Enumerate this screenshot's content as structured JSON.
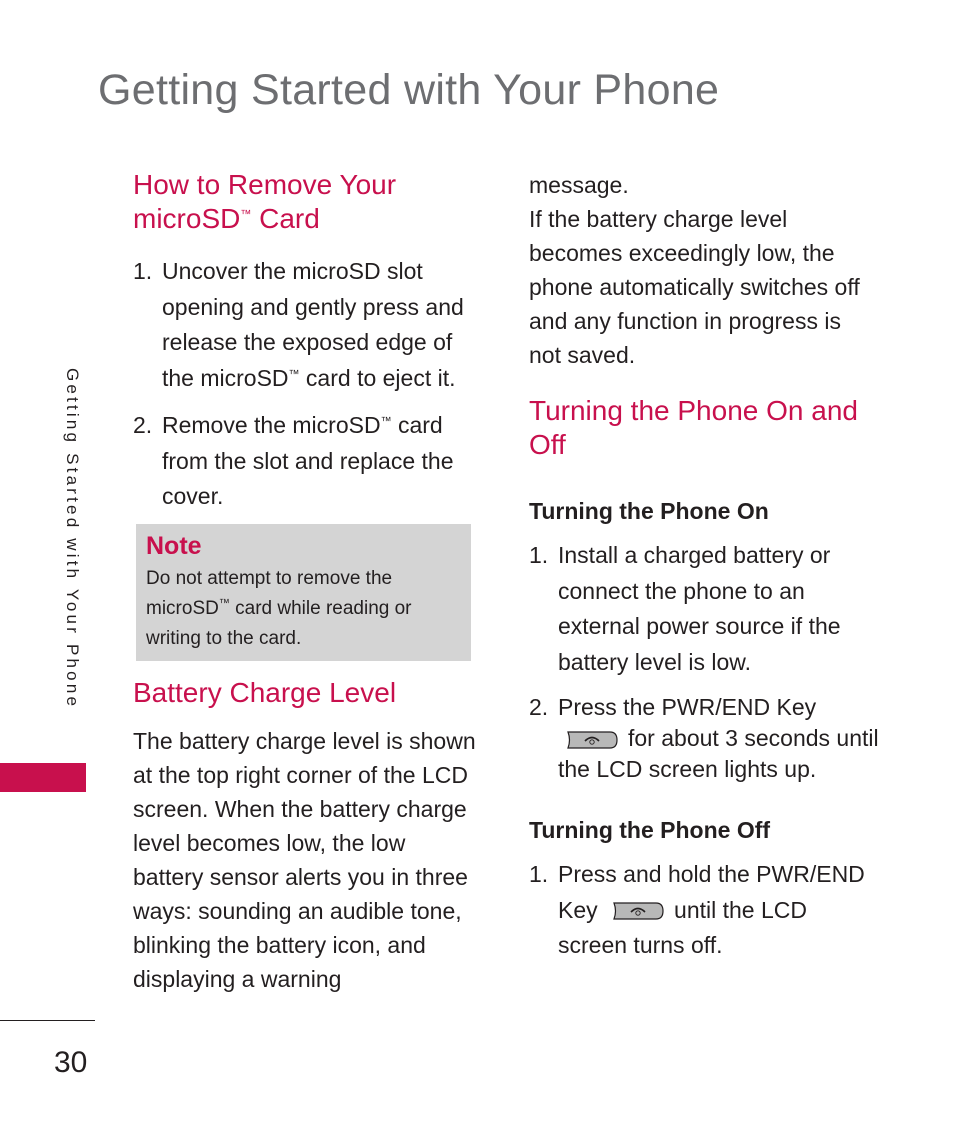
{
  "page": {
    "title": "Getting Started with Your Phone",
    "side_tab": "Getting Started with Your Phone",
    "page_number": "30",
    "accent_color": "#c8104d"
  },
  "remove_card": {
    "heading_line1": "How to Remove Your",
    "heading_line2_pre": "microSD",
    "heading_tm": "™",
    "heading_line2_post": " Card",
    "steps": [
      {
        "num": "1.",
        "text_pre": "Uncover the microSD slot opening and gently press and release the exposed edge of the microSD",
        "tm": "™",
        "text_post": " card to eject it."
      },
      {
        "num": "2.",
        "text_pre": "Remove the microSD",
        "tm": "™",
        "text_post": " card from the slot and replace the cover."
      }
    ]
  },
  "note": {
    "heading": "Note",
    "text_pre": "Do not attempt to remove the microSD",
    "tm": "™",
    "text_post": " card while reading or writing to the card."
  },
  "battery": {
    "heading": "Battery Charge Level",
    "para1": "The battery charge level is shown at the top right corner of the LCD screen. When the battery charge level becomes low, the low battery sensor alerts you in three ways: sounding an audible tone, blinking the battery icon, and displaying a warning",
    "para1_cont": "message.",
    "para2": "If the battery charge level becomes exceedingly low, the phone automatically switches off and any function in progress is not saved."
  },
  "power": {
    "heading": "Turning the Phone On and Off",
    "on_heading": "Turning the Phone On",
    "on_steps": [
      {
        "num": "1.",
        "text": "Install a charged battery or connect the phone to an external power source if the battery level is low."
      },
      {
        "num": "2.",
        "text_pre": "Press the PWR/END Key",
        "icon": "pwr-end-key-icon",
        "text_post": "for about 3 seconds until the LCD screen lights up."
      }
    ],
    "off_heading": "Turning the Phone Off",
    "off_steps": [
      {
        "num": "1.",
        "text_pre": "Press and hold the PWR/END Key",
        "icon": "pwr-end-key-icon",
        "text_post": "until the LCD screen turns off."
      }
    ]
  }
}
